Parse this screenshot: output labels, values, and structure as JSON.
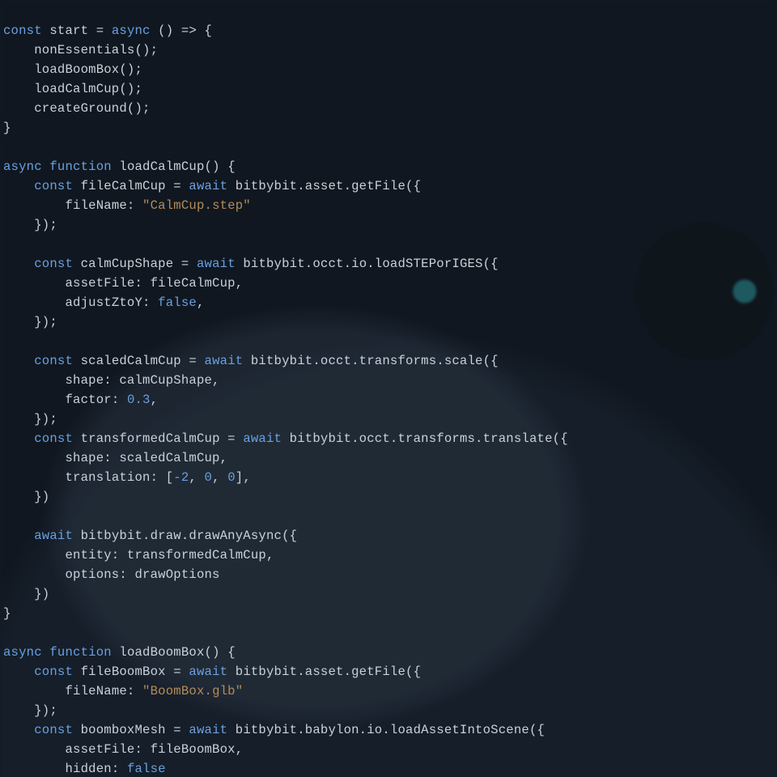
{
  "language": "typescript",
  "theme_colors": {
    "background": "#171f2a",
    "foreground": "#c9d1d9",
    "keyword": "#6aa0e0",
    "string": "#b58c59",
    "number": "#6aa0e0",
    "accent_teal": "#34c4c2"
  },
  "code": {
    "l01_const": "const",
    "l01_start": " start = ",
    "l01_async": "async",
    "l01_arrow": " () => {",
    "l02": "    nonEssentials();",
    "l03": "    loadBoomBox();",
    "l04": "    loadCalmCup();",
    "l05": "    createGround();",
    "l06": "}",
    "l08_async": "async",
    "l08_function": " function",
    "l08_sig": " loadCalmCup() {",
    "l09_indent": "    ",
    "l09_const": "const",
    "l09_rest": " fileCalmCup = ",
    "l09_await": "await",
    "l09_tail": " bitbybit.asset.getFile({",
    "l10_indent": "        ",
    "l10_key": "fileName: ",
    "l10_str": "\"CalmCup.step\"",
    "l11": "    });",
    "l13_const": "const",
    "l13_rest": " calmCupShape = ",
    "l13_await": "await",
    "l13_tail": " bitbybit.occt.io.loadSTEPorIGES({",
    "l14": "        assetFile: fileCalmCup,",
    "l15_indent": "        ",
    "l15_key": "adjustZtoY: ",
    "l15_false": "false",
    "l15_comma": ",",
    "l16": "    });",
    "l18_const": "const",
    "l18_rest": " scaledCalmCup = ",
    "l18_await": "await",
    "l18_tail": " bitbybit.occt.transforms.scale({",
    "l19": "        shape: calmCupShape,",
    "l20_indent": "        ",
    "l20_key": "factor: ",
    "l20_num": "0.3",
    "l20_comma": ",",
    "l21": "    });",
    "l22_const": "const",
    "l22_rest": " transformedCalmCup = ",
    "l22_await": "await",
    "l22_tail": " bitbybit.occt.transforms.translate({",
    "l23": "        shape: scaledCalmCup,",
    "l24_indent": "        ",
    "l24_key": "translation: [",
    "l24_n1": "-2",
    "l24_c1": ", ",
    "l24_n2": "0",
    "l24_c2": ", ",
    "l24_n3": "0",
    "l24_close": "],",
    "l25": "    })",
    "l27_await": "await",
    "l27_tail": " bitbybit.draw.drawAnyAsync({",
    "l28": "        entity: transformedCalmCup,",
    "l29": "        options: drawOptions",
    "l30": "    })",
    "l31": "}",
    "l33_async": "async",
    "l33_function": " function",
    "l33_sig": " loadBoomBox() {",
    "l34_const": "const",
    "l34_rest": " fileBoomBox = ",
    "l34_await": "await",
    "l34_tail": " bitbybit.asset.getFile({",
    "l35_indent": "        ",
    "l35_key": "fileName: ",
    "l35_str": "\"BoomBox.glb\"",
    "l36": "    });",
    "l37_const": "const",
    "l37_rest": " boomboxMesh = ",
    "l37_await": "await",
    "l37_tail": " bitbybit.babylon.io.loadAssetIntoScene({",
    "l38": "        assetFile: fileBoomBox,",
    "l39_indent": "        ",
    "l39_key": "hidden: ",
    "l39_false": "false"
  }
}
